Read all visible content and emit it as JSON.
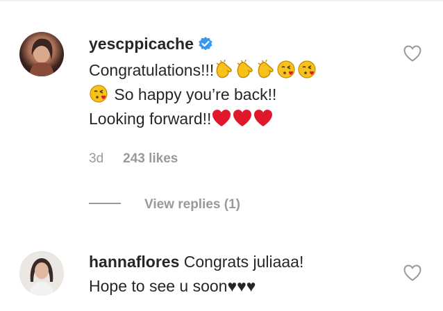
{
  "comments": [
    {
      "username": "yescppicache",
      "verified": true,
      "line1_text": "Congratulations!!!",
      "line1_emojis": [
        "clapping-hands",
        "clapping-hands",
        "clapping-hands",
        "face-blowing-kiss",
        "face-blowing-kiss"
      ],
      "line2_emoji": "face-blowing-kiss",
      "line2_text": " So happy you’re back!!",
      "line3_text": "Looking forward!!",
      "line3_emojis": [
        "red-heart",
        "red-heart",
        "red-heart"
      ],
      "time": "3d",
      "likes": "243 likes",
      "view_replies": "View replies (1)"
    },
    {
      "username": "hannaflores",
      "text_line1": "Congrats juliaaa!",
      "text_line2": "Hope to see u soon♥♥♥"
    }
  ],
  "colors": {
    "text": "#262626",
    "muted": "#999999",
    "verified_blue": "#3897f0",
    "heart_red": "#e0182b",
    "emoji_yellow": "#f8c21c"
  }
}
